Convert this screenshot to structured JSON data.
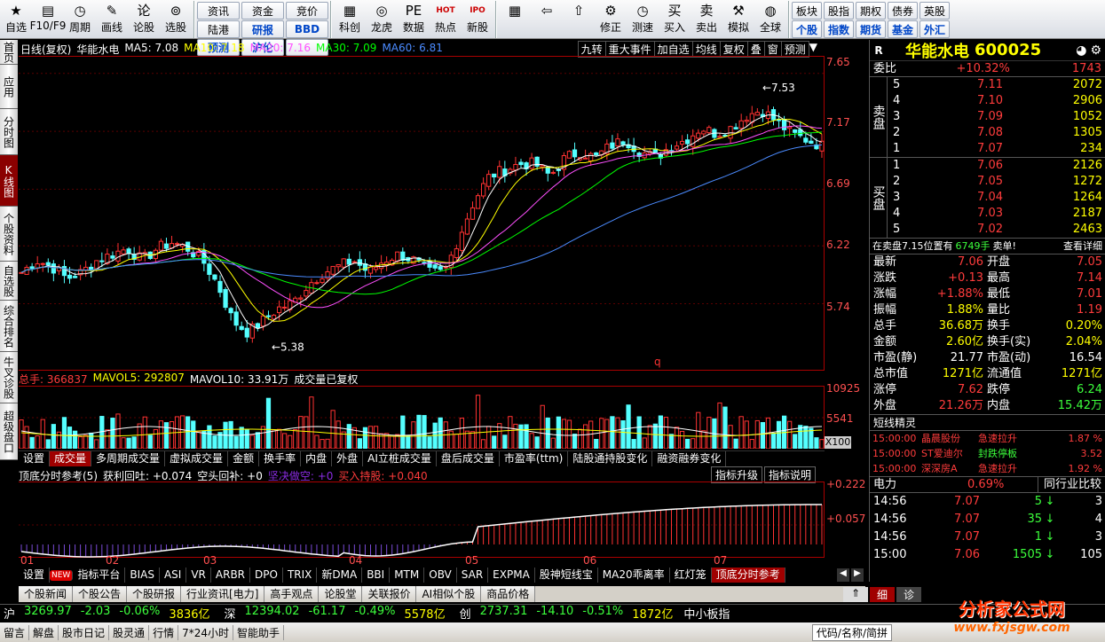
{
  "toolbar": {
    "left": [
      {
        "label": "自选",
        "icon": "star-icon",
        "glyph": "★"
      },
      {
        "label": "F10/F9",
        "icon": "f10-icon",
        "glyph": "▤"
      },
      {
        "label": "周期",
        "icon": "clock-icon",
        "glyph": "◷"
      },
      {
        "label": "画线",
        "icon": "pen-icon",
        "glyph": "✎"
      },
      {
        "label": "论股",
        "icon": "talk-icon",
        "glyph": "论"
      },
      {
        "label": "选股",
        "icon": "select-stock-icon",
        "glyph": "⊚"
      }
    ],
    "grid": [
      "资讯",
      "资金",
      "竞价",
      "陆港",
      "研报",
      "BBD",
      "预测",
      "沪伦"
    ],
    "mid": [
      {
        "label": "科创",
        "icon": "kechuang-icon",
        "glyph": "▦"
      },
      {
        "label": "龙虎",
        "icon": "dragon-tiger-icon",
        "glyph": "◎"
      },
      {
        "label": "数据",
        "icon": "data-icon",
        "glyph": "PE"
      },
      {
        "label": "热点",
        "icon": "hot-icon",
        "glyph": "HOT"
      },
      {
        "label": "新股",
        "icon": "ipo-icon",
        "glyph": "IPO"
      }
    ],
    "right": [
      {
        "label": "",
        "icon": "windows-icon",
        "glyph": "▦"
      },
      {
        "label": "",
        "icon": "back-arrow-icon",
        "glyph": "⇦"
      },
      {
        "label": "",
        "icon": "up-icon",
        "glyph": "⇧"
      },
      {
        "label": "修正",
        "icon": "fix-icon",
        "glyph": "⚙"
      },
      {
        "label": "测速",
        "icon": "speed-icon",
        "glyph": "◷"
      },
      {
        "label": "买入",
        "icon": "buy-icon",
        "glyph": "买"
      },
      {
        "label": "卖出",
        "icon": "sell-icon",
        "glyph": "卖"
      },
      {
        "label": "模拟",
        "icon": "simulate-icon",
        "glyph": "⚒"
      },
      {
        "label": "全球",
        "icon": "globe-icon",
        "glyph": "◍"
      }
    ],
    "grid2": [
      "板块",
      "股指",
      "期权",
      "债券",
      "英股",
      "个股",
      "指数",
      "期货",
      "基金",
      "外汇"
    ]
  },
  "leftnav": [
    "首页",
    "应用",
    "分时图",
    "K线图",
    "个股资料",
    "自选股",
    "综合排名",
    "牛叉诊股",
    "超级盘口"
  ],
  "kchart": {
    "title": "日线(复权)",
    "name": "华能水电",
    "ma": [
      {
        "label": "MA5: 7.08",
        "c": "#ffffff"
      },
      {
        "label": "MA10: 7.18",
        "c": "#ffff00"
      },
      {
        "label": "MA20: 7.16",
        "c": "#ff50ff"
      },
      {
        "label": "MA30: 7.09",
        "c": "#00ff00"
      },
      {
        "label": "MA60: 6.81",
        "c": "#4b8bff"
      }
    ],
    "toptabs": [
      "九转",
      "重大事件",
      "加自选",
      "均线",
      "复权",
      "叠",
      "窗",
      "预测"
    ],
    "yticks": [
      "7.65",
      "7.17",
      "6.69",
      "6.22",
      "5.74"
    ],
    "high_label": "7.53",
    "low_label": "5.38",
    "marker": "q",
    "xlabels": [
      "01",
      "02",
      "03",
      "04",
      "05",
      "06",
      "07"
    ]
  },
  "vol": {
    "label1": "总手: 366837",
    "label2": "MAVOL5: 292807",
    "label3": "MAVOL10: 33.91万",
    "label4": "成交量已复权",
    "yticks": [
      "10925",
      "5541"
    ],
    "unit": "X100"
  },
  "voltabs": [
    "设置",
    "成交量",
    "多周期成交量",
    "虚拟成交量",
    "金额",
    "换手率",
    "内盘",
    "外盘",
    "AI立桩成交量",
    "盘后成交量",
    "市盈率(ttm)",
    "陆股通持股变化",
    "融资融券变化"
  ],
  "ind": {
    "name": "顶底分时参考(5)",
    "t1": "获利回吐: +0.074",
    "t2": "空头回补: +0",
    "t3": "坚决做空: +0",
    "t4": "买入持股: +0.040",
    "btn1": "指标升级",
    "btn2": "指标说明",
    "yticks": [
      "+0.222",
      "+0.057"
    ]
  },
  "bottomtabs": [
    "设置",
    "NEW",
    "指标平台",
    "BIAS",
    "ASI",
    "VR",
    "ARBR",
    "DPO",
    "TRIX",
    "新DMA",
    "BBI",
    "MTM",
    "OBV",
    "SAR",
    "EXPMA",
    "股神短线宝",
    "MA20乖离率",
    "红灯笼",
    "顶底分时参考"
  ],
  "newsbar": [
    "个股新闻",
    "个股公告",
    "个股研报",
    "行业资讯[电力]",
    "高手观点",
    "论股堂",
    "关联报价",
    "AI相似个股",
    "商品价格"
  ],
  "right": {
    "R": "R",
    "name": "华能水电",
    "code": "600025",
    "weibi": "委比",
    "weibi_v": "+10.32%",
    "weibi_n": "1743",
    "sell_label": "卖盘",
    "buy_label": "买盘",
    "asks": [
      {
        "l": "5",
        "p": "7.11",
        "v": "2072"
      },
      {
        "l": "4",
        "p": "7.10",
        "v": "2906"
      },
      {
        "l": "3",
        "p": "7.09",
        "v": "1052"
      },
      {
        "l": "2",
        "p": "7.08",
        "v": "1305"
      },
      {
        "l": "1",
        "p": "7.07",
        "v": "234"
      }
    ],
    "bids": [
      {
        "l": "1",
        "p": "7.06",
        "v": "2126"
      },
      {
        "l": "2",
        "p": "7.05",
        "v": "1272"
      },
      {
        "l": "3",
        "p": "7.04",
        "v": "1264"
      },
      {
        "l": "4",
        "p": "7.03",
        "v": "2187"
      },
      {
        "l": "5",
        "p": "7.02",
        "v": "2463"
      }
    ],
    "notice1": "在卖盘7.15位置有",
    "notice2": "6749手",
    "notice3": "卖单!",
    "notice4": "查看详细",
    "stats": [
      {
        "a": "最新",
        "av": "7.06",
        "ac": "red",
        "b": "开盘",
        "bv": "7.05",
        "bc": "red"
      },
      {
        "a": "涨跌",
        "av": "+0.13",
        "ac": "red",
        "b": "最高",
        "bv": "7.14",
        "bc": "red"
      },
      {
        "a": "涨幅",
        "av": "+1.88%",
        "ac": "red",
        "b": "最低",
        "bv": "7.01",
        "bc": "red"
      },
      {
        "a": "振幅",
        "av": "1.88%",
        "ac": "yel",
        "b": "量比",
        "bv": "1.19",
        "bc": "red"
      },
      {
        "a": "总手",
        "av": "36.68万",
        "ac": "yel",
        "b": "换手",
        "bv": "0.20%",
        "bc": "yel"
      },
      {
        "a": "金额",
        "av": "2.60亿",
        "ac": "yel",
        "b": "换手(实)",
        "bv": "2.04%",
        "bc": "yel"
      },
      {
        "a": "市盈(静)",
        "av": "21.77",
        "ac": "wht",
        "b": "市盈(动)",
        "bv": "16.54",
        "bc": "wht"
      },
      {
        "a": "总市值",
        "av": "1271亿",
        "ac": "yel",
        "b": "流通值",
        "bv": "1271亿",
        "bc": "yel"
      },
      {
        "a": "涨停",
        "av": "7.62",
        "ac": "red",
        "b": "跌停",
        "bv": "6.24",
        "bc": "grn"
      },
      {
        "a": "外盘",
        "av": "21.26万",
        "ac": "red",
        "b": "内盘",
        "bv": "15.42万",
        "bc": "grn"
      }
    ],
    "sprite_title": "短线精灵",
    "sprites": [
      {
        "t": "15:00:00",
        "n": "晶晨股份",
        "e": "急速拉升",
        "v": "1.87 %"
      },
      {
        "t": "15:00:00",
        "n": "ST爱迪尔",
        "e": "封跌停板",
        "v": "3.52"
      },
      {
        "t": "15:00:00",
        "n": "深深房A",
        "e": "急速拉升",
        "v": "1.92 %"
      }
    ],
    "industry": "电力",
    "industry_v": "0.69%",
    "industry_btn": "同行业比较",
    "ticks": [
      {
        "t": "14:56",
        "p": "7.07",
        "v": "5",
        "d": "down",
        "x": "3"
      },
      {
        "t": "14:56",
        "p": "7.07",
        "v": "35",
        "d": "down",
        "x": "4"
      },
      {
        "t": "14:56",
        "p": "7.07",
        "v": "1",
        "d": "down",
        "x": "3"
      },
      {
        "t": "15:00",
        "p": "7.06",
        "v": "1505",
        "d": "down",
        "x": "105"
      }
    ],
    "tab1": "细",
    "tab2": "诊"
  },
  "indexbar": [
    {
      "n": "沪",
      "v": "3269.97",
      "c": "-2.03",
      "p": "-0.06%",
      "a": "3836亿"
    },
    {
      "n": "深",
      "v": "12394.02",
      "c": "-61.17",
      "p": "-0.49%",
      "a": "5578亿"
    },
    {
      "n": "创",
      "v": "2737.31",
      "c": "-14.10",
      "p": "-0.51%",
      "a": "1872亿"
    }
  ],
  "indexbar_tail": "中小板指",
  "statusbar": [
    "留言",
    "解盘",
    "股市日记",
    "股灵通",
    "行情",
    "7*24小时",
    "智能助手"
  ],
  "statusbar_right": "代码/名称/简拼",
  "watermark": "分析家公式网",
  "watermark_url": "www.fxjsgw.com"
}
